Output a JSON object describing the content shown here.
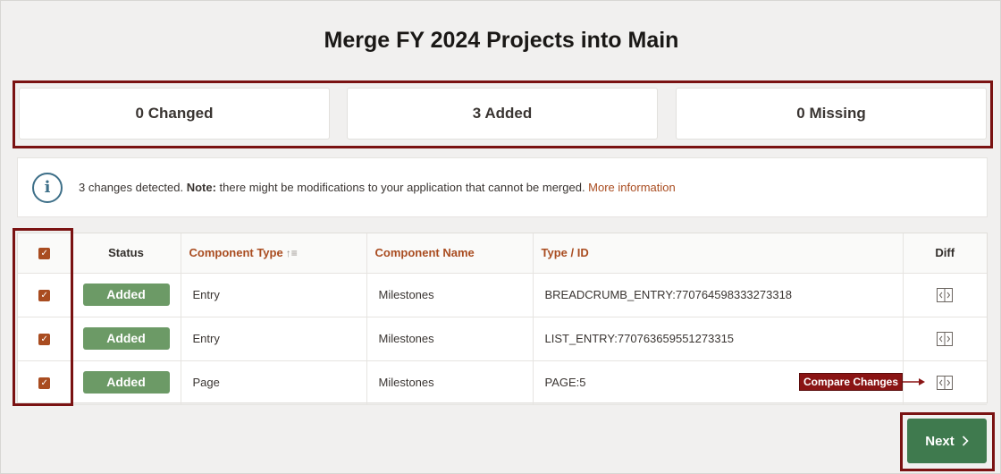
{
  "page": {
    "title": "Merge FY 2024 Projects into Main"
  },
  "summary": {
    "changed": "0 Changed",
    "added": "3 Added",
    "missing": "0 Missing"
  },
  "info": {
    "icon": "info-icon",
    "text_before": "3 changes detected. ",
    "note_label": "Note:",
    "text_after": " there might be modifications to your application that cannot be merged. ",
    "link": "More information"
  },
  "table": {
    "columns": {
      "status": "Status",
      "component_type": "Component Type",
      "component_name": "Component Name",
      "type_id": "Type / ID",
      "diff": "Diff"
    },
    "rows": [
      {
        "checked": true,
        "status": "Added",
        "component_type": "Entry",
        "component_name": "Milestones",
        "type_id": "BREADCRUMB_ENTRY:770764598333273318"
      },
      {
        "checked": true,
        "status": "Added",
        "component_type": "Entry",
        "component_name": "Milestones",
        "type_id": "LIST_ENTRY:770763659551273315"
      },
      {
        "checked": true,
        "status": "Added",
        "component_type": "Page",
        "component_name": "Milestones",
        "type_id": "PAGE:5"
      }
    ]
  },
  "callout": {
    "label": "Compare Changes"
  },
  "footer": {
    "next_label": "Next"
  },
  "colors": {
    "accent": "#a94c20",
    "added_badge": "#6c9a66",
    "next_button": "#3f7a4e",
    "highlight": "#7a1212"
  }
}
